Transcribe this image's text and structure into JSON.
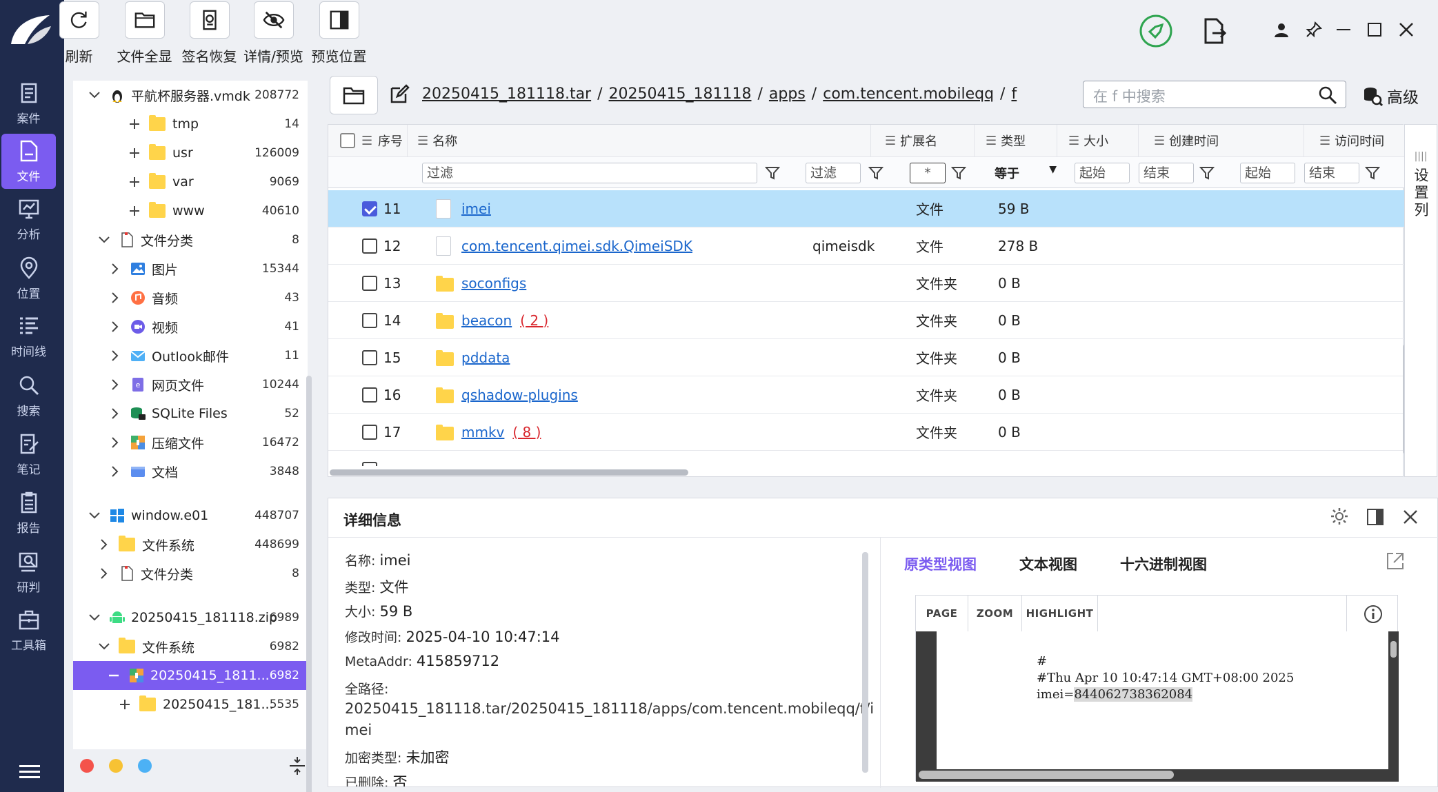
{
  "toolbar": [
    {
      "label": "刷新",
      "icon": "refresh-icon"
    },
    {
      "label": "文件全显",
      "icon": "folder-icon"
    },
    {
      "label": "签名恢复",
      "icon": "signature-icon"
    },
    {
      "label": "详情/预览",
      "icon": "eye-off-icon"
    },
    {
      "label": "预览位置",
      "icon": "panel-right-icon"
    }
  ],
  "nav": [
    "案件",
    "文件",
    "分析",
    "位置",
    "时间线",
    "搜索",
    "笔记",
    "报告",
    "研判",
    "工具箱"
  ],
  "nav_active": "文件",
  "tree": [
    {
      "label": "平航杯服务器.vmdk",
      "count": "208772"
    },
    {
      "label": "tmp",
      "count": "14"
    },
    {
      "label": "usr",
      "count": "126009"
    },
    {
      "label": "var",
      "count": "9069"
    },
    {
      "label": "www",
      "count": "40610"
    },
    {
      "label": "文件分类",
      "count": "8"
    },
    {
      "label": "图片",
      "count": "15344"
    },
    {
      "label": "音频",
      "count": "43"
    },
    {
      "label": "视频",
      "count": "41"
    },
    {
      "label": "Outlook邮件",
      "count": "11"
    },
    {
      "label": "网页文件",
      "count": "10244"
    },
    {
      "label": "SQLite Files",
      "count": "52"
    },
    {
      "label": "压缩文件",
      "count": "16472"
    },
    {
      "label": "文档",
      "count": "3848"
    },
    {
      "label": "window.e01",
      "count": "448707"
    },
    {
      "label": "文件系统",
      "count": "448699"
    },
    {
      "label": "文件分类",
      "count": "8"
    },
    {
      "label": "20250415_181118.zip",
      "count": "6989"
    },
    {
      "label": "文件系统",
      "count": "6982"
    },
    {
      "label": "20250415_1811...",
      "count": "6982"
    },
    {
      "label": "20250415_181...",
      "count": "5535"
    }
  ],
  "path": [
    "20250415_181118.tar",
    "20250415_181118",
    "apps",
    "com.tencent.mobileqq",
    "f"
  ],
  "path_sep": "/",
  "search": {
    "placeholder": "在 f 中搜索",
    "advanced": "高级"
  },
  "columns": [
    "序号",
    "名称",
    "扩展名",
    "类型",
    "大小",
    "创建时间",
    "访问时间"
  ],
  "filters": {
    "name": "过滤",
    "ext": "过滤",
    "type": "*",
    "size": "等于",
    "c_start": "起始",
    "c_end": "结束",
    "a_start": "起始",
    "a_end": "结束"
  },
  "side_config": "设置列",
  "rows": [
    {
      "idx": "11",
      "name": "imei",
      "ext": "",
      "type": "文件",
      "size": "59 B",
      "kind": "file",
      "checked": true,
      "badge": ""
    },
    {
      "idx": "12",
      "name": "com.tencent.qimei.sdk.QimeiSDK",
      "ext": "qimeisdk",
      "type": "文件",
      "size": "278 B",
      "kind": "file",
      "checked": false,
      "badge": ""
    },
    {
      "idx": "13",
      "name": "soconfigs",
      "ext": "",
      "type": "文件夹",
      "size": "0 B",
      "kind": "folder",
      "checked": false,
      "badge": ""
    },
    {
      "idx": "14",
      "name": "beacon",
      "ext": "",
      "type": "文件夹",
      "size": "0 B",
      "kind": "folder",
      "checked": false,
      "badge": "( 2 )"
    },
    {
      "idx": "15",
      "name": "pddata",
      "ext": "",
      "type": "文件夹",
      "size": "0 B",
      "kind": "folder",
      "checked": false,
      "badge": ""
    },
    {
      "idx": "16",
      "name": "qshadow-plugins",
      "ext": "",
      "type": "文件夹",
      "size": "0 B",
      "kind": "folder",
      "checked": false,
      "badge": ""
    },
    {
      "idx": "17",
      "name": "mmkv",
      "ext": "",
      "type": "文件夹",
      "size": "0 B",
      "kind": "folder",
      "checked": false,
      "badge": "( 8 )"
    }
  ],
  "details": {
    "title": "详细信息",
    "name_l": "名称:",
    "name_v": "imei",
    "type_l": "类型:",
    "type_v": "文件",
    "size_l": "大小:",
    "size_v": "59 B",
    "mtime_l": "修改时间:",
    "mtime_v": "2025-04-10 10:47:14",
    "meta_l": "MetaAddr:",
    "meta_v": "415859712",
    "path_l": "全路径:",
    "path_v1": "20250415_181118.tar/20250415_181118/apps/com.tencent.mobileqq/f/i",
    "path_v2": "mei",
    "enc_l": "加密类型:",
    "enc_v": "未加密",
    "del_l": "已删除:",
    "del_v": "否"
  },
  "viewer": {
    "tabs": [
      "原类型视图",
      "文本视图",
      "十六进制视图"
    ],
    "buttons": [
      "PAGE",
      "ZOOM",
      "HIGHLIGHT"
    ],
    "line1": "#",
    "line2": "#Thu Apr 10 10:47:14 GMT+08:00 2025",
    "line3_a": "imei=",
    "line3_b": "844062738362084"
  },
  "colors": {
    "nav": "#1f2b4d",
    "accent": "#7b5cf0",
    "selected_row": "#b8e1fb",
    "link": "#1a66cc",
    "badge": "#d9272e"
  }
}
